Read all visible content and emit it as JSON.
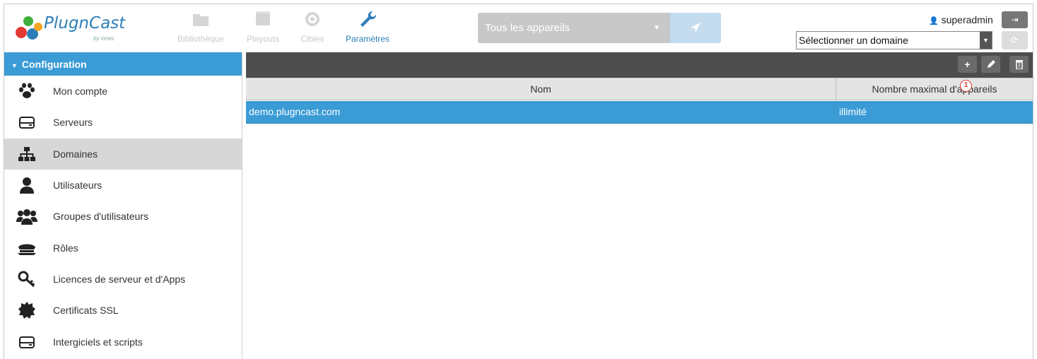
{
  "app": {
    "brand": "PlugnCast",
    "brand_sub": "by innes"
  },
  "nav": [
    {
      "label": "Bibliothèque",
      "icon": "folder-icon",
      "active": false
    },
    {
      "label": "Playouts",
      "icon": "film-icon",
      "active": false
    },
    {
      "label": "Cibles",
      "icon": "target-icon",
      "active": false
    },
    {
      "label": "Paramètres",
      "icon": "wrench-icon",
      "active": true
    }
  ],
  "devices": {
    "selected": "Tous les appareils"
  },
  "user": {
    "name": "superadmin"
  },
  "domain_select": {
    "value": "Sélectionner un domaine"
  },
  "sidebar": {
    "title": "Configuration",
    "items": [
      {
        "label": "Mon compte",
        "icon": "paw-icon"
      },
      {
        "label": "Serveurs",
        "icon": "server-icon"
      },
      {
        "label": "Domaines",
        "icon": "sitemap-icon"
      },
      {
        "label": "Utilisateurs",
        "icon": "user-icon"
      },
      {
        "label": "Groupes d'utilisateurs",
        "icon": "users-icon"
      },
      {
        "label": "Rôles",
        "icon": "cap-icon"
      },
      {
        "label": "Licences de serveur et d'Apps",
        "icon": "key-icon"
      },
      {
        "label": "Certificats SSL",
        "icon": "certificate-icon"
      },
      {
        "label": "Intergiciels et scripts",
        "icon": "server-icon"
      }
    ],
    "active_index": 2
  },
  "toolbar": {
    "add": "+",
    "badge": "1"
  },
  "table": {
    "columns": [
      "Nom",
      "Nombre maximal d'appareils"
    ],
    "rows": [
      [
        "demo.plugncast.com",
        "illimité"
      ]
    ]
  },
  "colors": {
    "accent": "#3a9bd5",
    "toolbar": "#4d4d4d"
  }
}
